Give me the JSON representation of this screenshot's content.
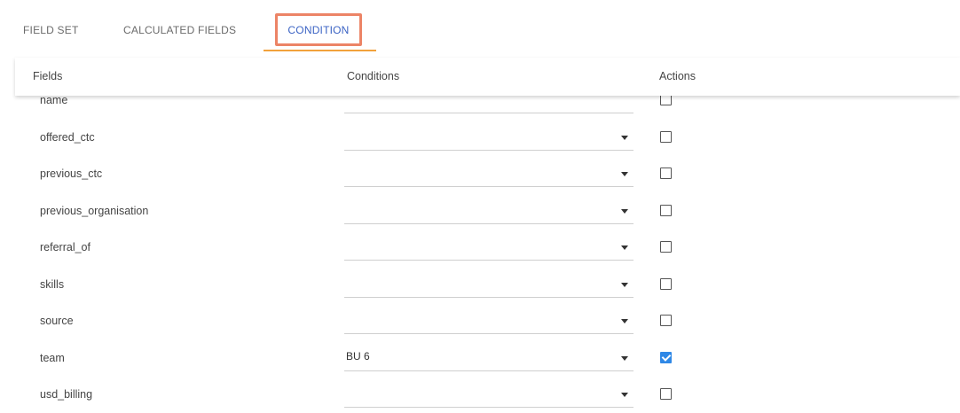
{
  "tabs": [
    {
      "label": "FIELD SET",
      "active": false
    },
    {
      "label": "CALCULATED FIELDS",
      "active": false
    },
    {
      "label": "CONDITION",
      "active": true
    }
  ],
  "table": {
    "headers": {
      "fields": "Fields",
      "conditions": "Conditions",
      "actions": "Actions"
    },
    "rows": [
      {
        "field": "name",
        "condition": "",
        "has_dropdown": false,
        "checked": false
      },
      {
        "field": "offered_ctc",
        "condition": "",
        "has_dropdown": true,
        "checked": false
      },
      {
        "field": "previous_ctc",
        "condition": "",
        "has_dropdown": true,
        "checked": false
      },
      {
        "field": "previous_organisation",
        "condition": "",
        "has_dropdown": true,
        "checked": false
      },
      {
        "field": "referral_of",
        "condition": "",
        "has_dropdown": true,
        "checked": false
      },
      {
        "field": "skills",
        "condition": "",
        "has_dropdown": true,
        "checked": false
      },
      {
        "field": "source",
        "condition": "",
        "has_dropdown": true,
        "checked": false
      },
      {
        "field": "team",
        "condition": "BU 6",
        "has_dropdown": true,
        "checked": true
      },
      {
        "field": "usd_billing",
        "condition": "",
        "has_dropdown": true,
        "checked": false
      }
    ]
  },
  "colors": {
    "active_tab_text": "#3b63c4",
    "highlight_border": "#ec8466",
    "tab_underline": "#f2a23b",
    "checkbox_checked": "#2f88e6"
  }
}
